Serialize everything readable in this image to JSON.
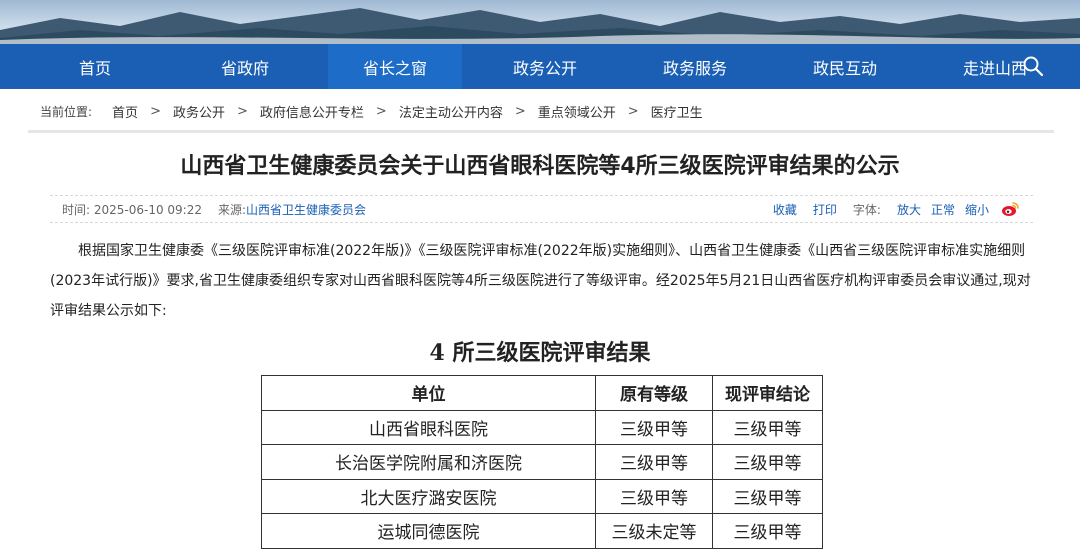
{
  "nav": {
    "items": [
      "首页",
      "省政府",
      "省长之窗",
      "政务公开",
      "政务服务",
      "政民互动",
      "走进山西"
    ],
    "active_index": 2
  },
  "breadcrumb": {
    "label": "当前位置:",
    "items": [
      "首页",
      "政务公开",
      "政府信息公开专栏",
      "法定主动公开内容",
      "重点领域公开",
      "医疗卫生"
    ],
    "separator": ">"
  },
  "article": {
    "title": "山西省卫生健康委员会关于山西省眼科医院等4所三级医院评审结果的公示",
    "time": "时间: 2025-06-10 09:22",
    "source_label": "来源:",
    "source": "山西省卫生健康委员会",
    "tools": {
      "favorite": "收藏",
      "print": "打印",
      "font_label": "字体:",
      "font_large": "放大",
      "font_normal": "正常",
      "font_small": "缩小"
    },
    "body": "根据国家卫生健康委《三级医院评审标准(2022年版)》《三级医院评审标准(2022年版)实施细则》、山西省卫生健康委《山西省三级医院评审标准实施细则(2023年试行版)》要求,省卫生健康委组织专家对山西省眼科医院等4所三级医院进行了等级评审。经2025年5月21日山西省医疗机构评审委员会审议通过,现对评审结果公示如下:"
  },
  "results_table": {
    "title": "4 所三级医院评审结果",
    "headers": [
      "单位",
      "原有等级",
      "现评审结论"
    ],
    "rows": [
      [
        "山西省眼科医院",
        "三级甲等",
        "三级甲等"
      ],
      [
        "长治医学院附属和济医院",
        "三级甲等",
        "三级甲等"
      ],
      [
        "北大医疗潞安医院",
        "三级甲等",
        "三级甲等"
      ],
      [
        "运城同德医院",
        "三级未定等",
        "三级甲等"
      ]
    ]
  },
  "icons": [
    "search-icon",
    "weibo-icon"
  ],
  "colors": {
    "nav_bg": "#1a5fb4",
    "nav_active": "#1d6cc8",
    "link": "#1a5fb4"
  }
}
